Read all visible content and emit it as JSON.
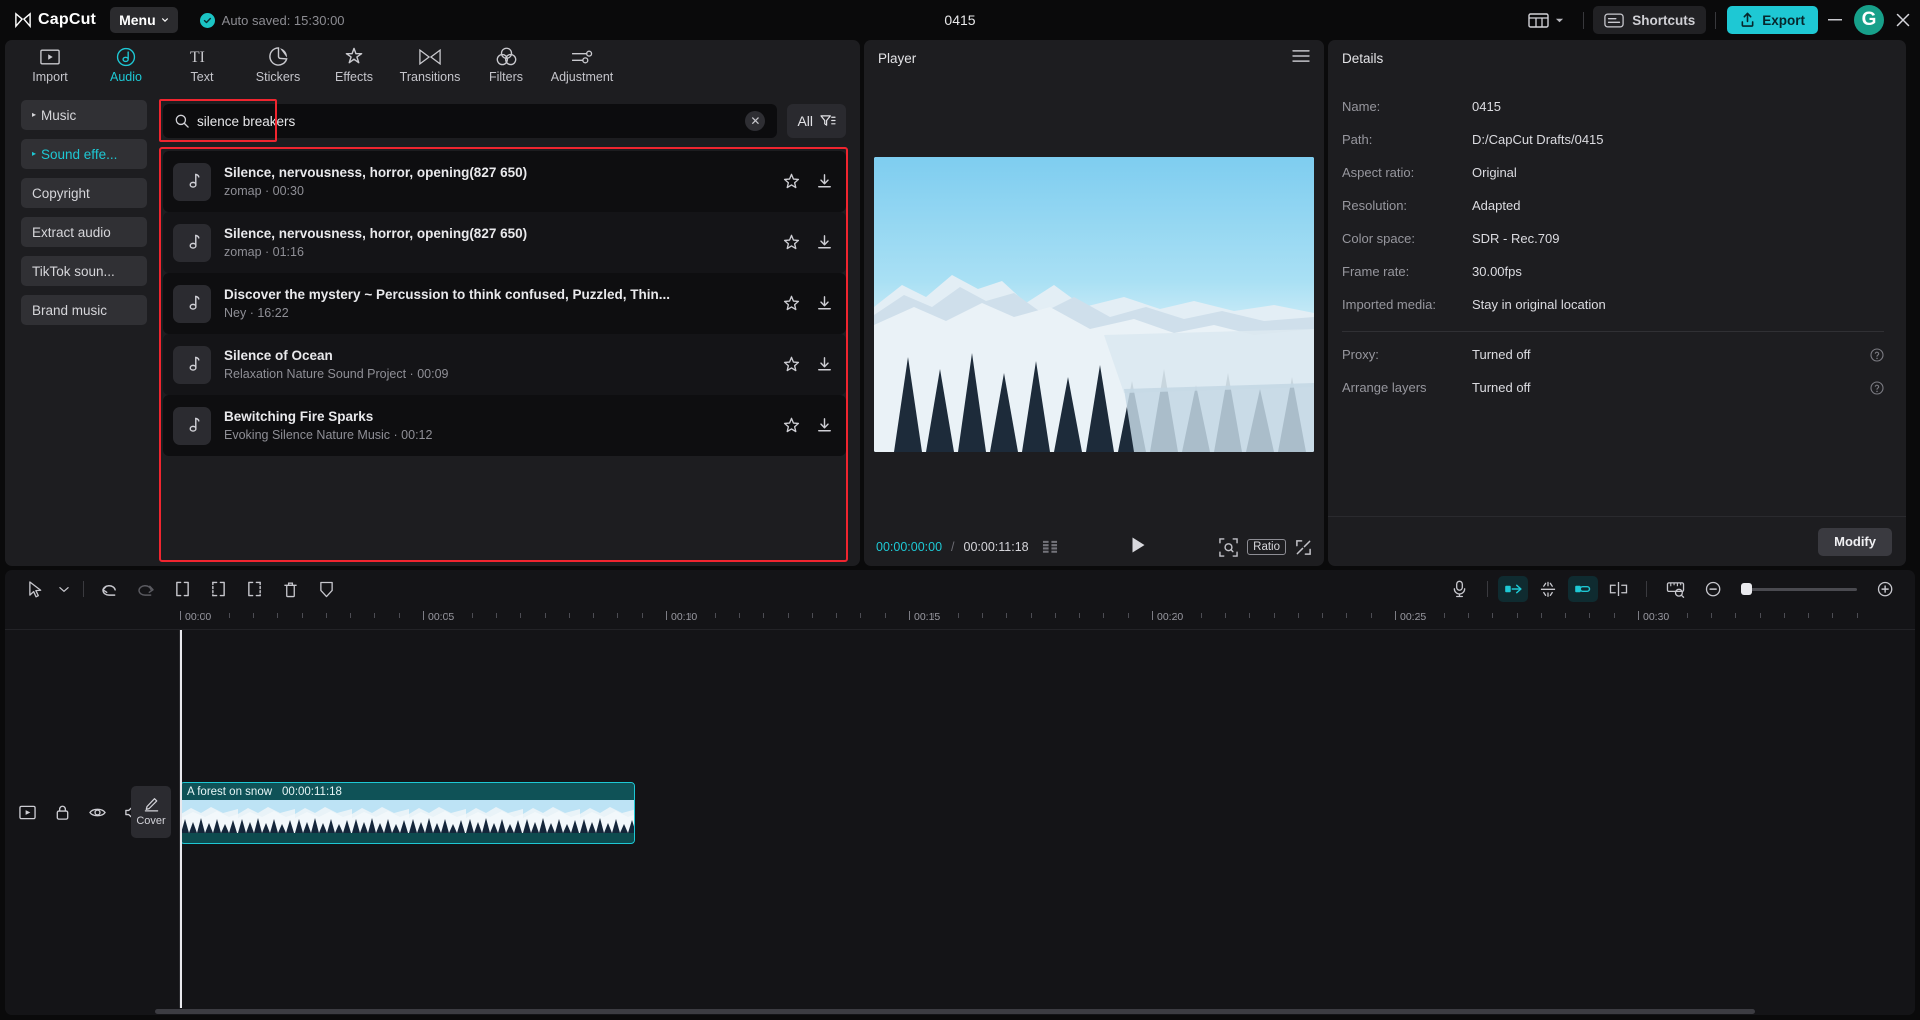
{
  "titlebar": {
    "brand": "CapCut",
    "menu_label": "Menu",
    "autosave_text": "Auto saved: 15:30:00",
    "doc_title": "0415",
    "shortcuts_label": "Shortcuts",
    "export_label": "Export",
    "avatar_letter": "G",
    "accent_teal": "#1ec8d4"
  },
  "tabs": [
    {
      "label": "Import",
      "icon": "import-icon",
      "active": false
    },
    {
      "label": "Audio",
      "icon": "audio-note-icon",
      "active": true
    },
    {
      "label": "Text",
      "icon": "text-icon",
      "active": false
    },
    {
      "label": "Stickers",
      "icon": "sticker-icon",
      "active": false
    },
    {
      "label": "Effects",
      "icon": "effects-star-icon",
      "active": false
    },
    {
      "label": "Transitions",
      "icon": "transitions-icon",
      "active": false
    },
    {
      "label": "Filters",
      "icon": "filters-icon",
      "active": false
    },
    {
      "label": "Adjustment",
      "icon": "adjustment-icon",
      "active": false
    }
  ],
  "categories": [
    {
      "label": "Music",
      "arrow": "▸",
      "active": false
    },
    {
      "label": "Sound effe...",
      "arrow": "▸",
      "active": true
    },
    {
      "label": "Copyright",
      "arrow": "",
      "active": false
    },
    {
      "label": "Extract audio",
      "arrow": "",
      "active": false
    },
    {
      "label": "TikTok soun...",
      "arrow": "",
      "active": false
    },
    {
      "label": "Brand music",
      "arrow": "",
      "active": false
    }
  ],
  "search": {
    "value": "silence breakers",
    "placeholder": "Search",
    "filter_label": "All"
  },
  "audio_results": [
    {
      "title": "Silence, nervousness, horror, opening(827 650)",
      "artist": "zomap",
      "duration": "00:30"
    },
    {
      "title": "Silence, nervousness, horror, opening(827 650)",
      "artist": "zomap",
      "duration": "01:16"
    },
    {
      "title": "Discover the mystery ~ Percussion to think confused, Puzzled, Thin...",
      "artist": "Ney",
      "duration": "16:22"
    },
    {
      "title": "Silence of Ocean",
      "artist": "Relaxation Nature Sound Project",
      "duration": "00:09"
    },
    {
      "title": "Bewitching Fire Sparks",
      "artist": "Evoking Silence Nature Music",
      "duration": "00:12"
    }
  ],
  "player": {
    "title": "Player",
    "current_time": "00:00:00:00",
    "separator": "/",
    "total_time": "00:00:11:18",
    "ratio_label": "Ratio"
  },
  "details": {
    "title": "Details",
    "rows": [
      {
        "key": "Name:",
        "value": "0415",
        "help": false
      },
      {
        "key": "Path:",
        "value": "D:/CapCut Drafts/0415",
        "help": false
      },
      {
        "key": "Aspect ratio:",
        "value": "Original",
        "help": false
      },
      {
        "key": "Resolution:",
        "value": "Adapted",
        "help": false
      },
      {
        "key": "Color space:",
        "value": "SDR - Rec.709",
        "help": false
      },
      {
        "key": "Frame rate:",
        "value": "30.00fps",
        "help": false
      },
      {
        "key": "Imported media:",
        "value": "Stay in original location",
        "help": false
      }
    ],
    "rows2": [
      {
        "key": "Proxy:",
        "value": "Turned off",
        "help": true
      },
      {
        "key": "Arrange layers",
        "value": "Turned off",
        "help": true
      }
    ],
    "modify_label": "Modify"
  },
  "timeline": {
    "ruler_labels": [
      "00:00",
      "00:05",
      "00:10",
      "00:15",
      "00:20",
      "00:25",
      "00:30"
    ],
    "cover_label": "Cover",
    "clip": {
      "name": "A forest on snow",
      "duration": "00:00:11:18"
    }
  }
}
